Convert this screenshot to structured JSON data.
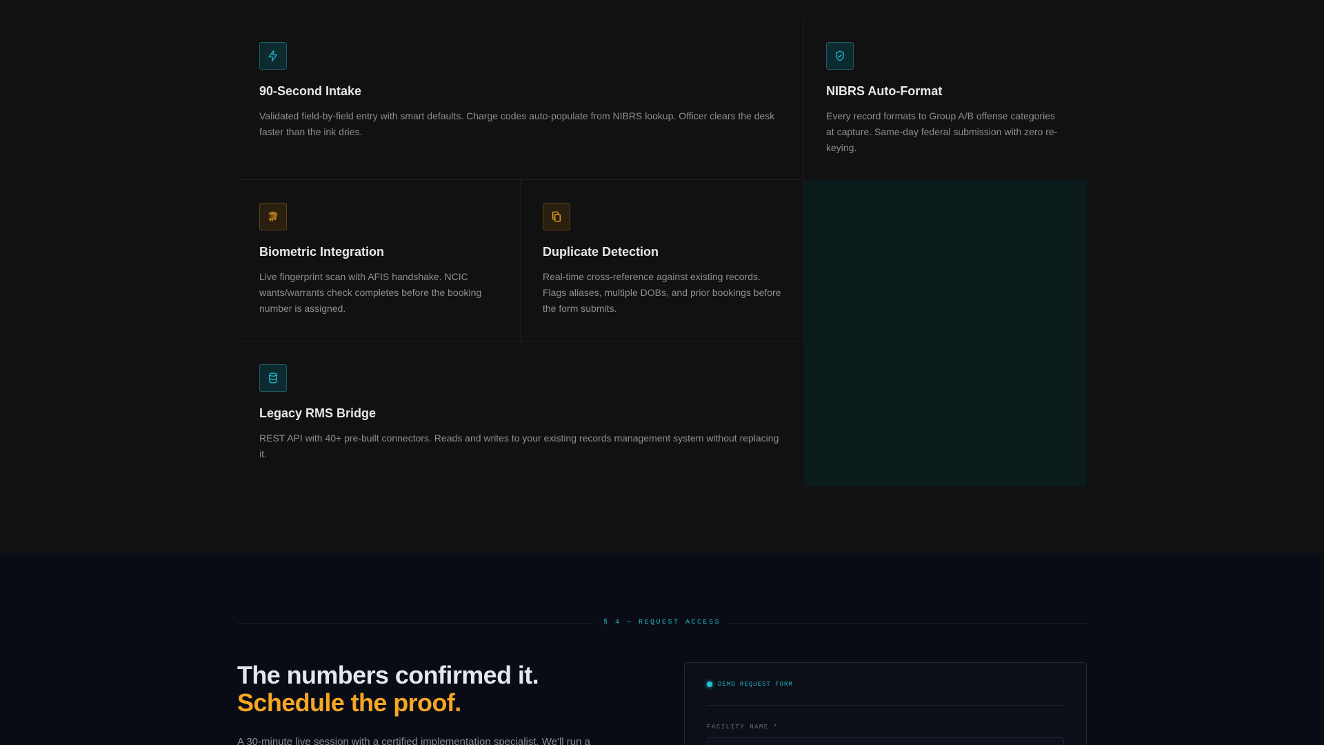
{
  "features": [
    {
      "title": "90-Second Intake",
      "body": "Validated field-by-field entry with smart defaults. Charge codes auto-populate from NIBRS lookup. Officer clears the desk faster than the ink dries.",
      "icon": "lightning-icon",
      "accent": "#22b8c9"
    },
    {
      "title": "NIBRS Auto-Format",
      "body": "Every record formats to Group A/B offense categories at capture. Same-day federal submission with zero re-keying.",
      "icon": "shield-check-icon",
      "accent": "#22b8c9"
    },
    {
      "title": "Biometric Integration",
      "body": "Live fingerprint scan with AFIS handshake. NCIC wants/warrants check completes before the booking number is assigned.",
      "icon": "fingerprint-icon",
      "accent": "#f5a623"
    },
    {
      "title": "Duplicate Detection",
      "body": "Real-time cross-reference against existing records. Flags aliases, multiple DOBs, and prior bookings before the form submits.",
      "icon": "copy-icon",
      "accent": "#f5a623"
    },
    {
      "title": "Legacy RMS Bridge",
      "body": "REST API with 40+ pre-built connectors. Reads and writes to your existing records management system without replacing it.",
      "icon": "database-icon",
      "accent": "#22b8c9"
    }
  ],
  "request": {
    "section_label": "§ 4 — REQUEST ACCESS",
    "headline_line1": "The numbers confirmed it.",
    "headline_line2": "Schedule the proof.",
    "lead": "A 30-minute live session with a certified implementation specialist. We'll run a",
    "form": {
      "title": "DEMO REQUEST FORM",
      "field_label": "FACILITY NAME *"
    }
  },
  "colors": {
    "accent_teal": "#22b8c9",
    "accent_amber": "#f5a623",
    "background": "#111111",
    "section_background": "#0a0c15"
  }
}
